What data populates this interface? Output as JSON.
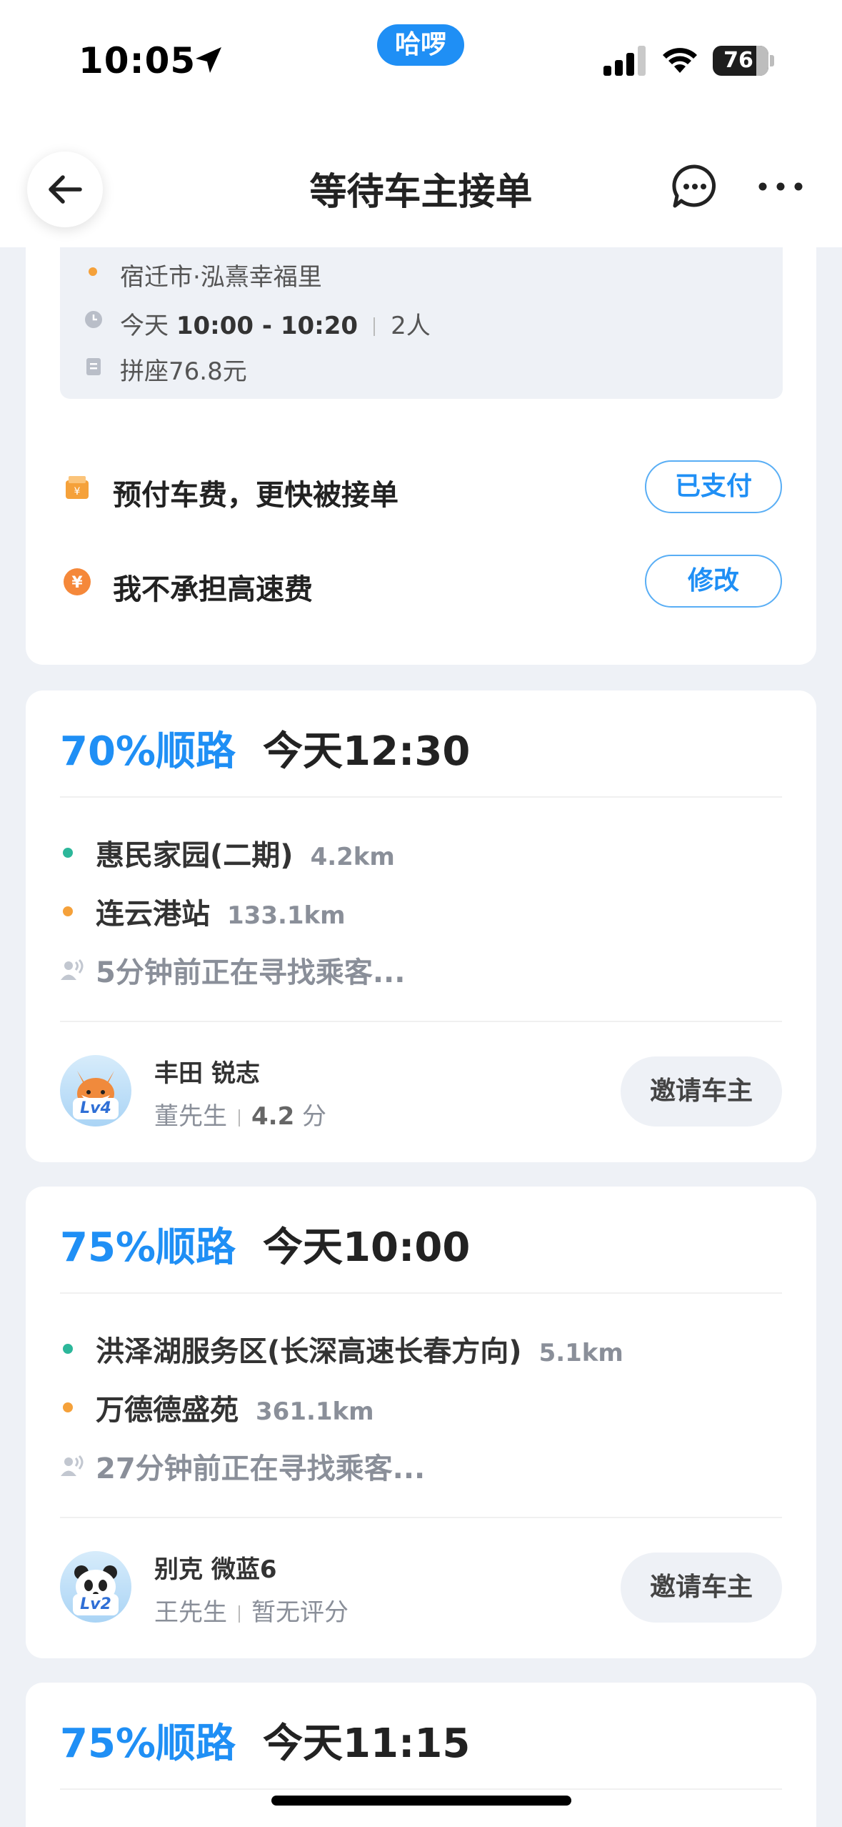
{
  "status_bar": {
    "time": "10:05",
    "pill": "哈啰",
    "battery": "76"
  },
  "nav": {
    "title": "等待车主接单",
    "icons": [
      "back-arrow-icon",
      "chat-bubble-icon",
      "more-dots-icon"
    ]
  },
  "summary": {
    "destination": "宿迁市·泓熹幸福里",
    "time_prefix": "今天",
    "time_range": "10:00 - 10:20",
    "passengers": "2人",
    "price": "拼座76.8元"
  },
  "options": [
    {
      "label": "预付车费，更快被接单",
      "button": "已支付",
      "icon": "wallet-icon"
    },
    {
      "label": "我不承担高速费",
      "button": "修改",
      "icon": "yen-coin-icon"
    }
  ],
  "rides": [
    {
      "match": "70%顺路",
      "time_prefix": "今天",
      "time": "12:30",
      "start": "惠民家园(二期)",
      "start_km": "4.2km",
      "end": "连云港站",
      "end_km": "133.1km",
      "status": "5分钟前正在寻找乘客...",
      "car": "丰田 锐志",
      "driver": "董先生",
      "score_value": "4.2",
      "score_unit": "分",
      "level": "Lv4",
      "avatar": "fox-avatar",
      "invite": "邀请车主"
    },
    {
      "match": "75%顺路",
      "time_prefix": "今天",
      "time": "10:00",
      "start": "洪泽湖服务区(长深高速长春方向)",
      "start_km": "5.1km",
      "end": "万德德盛苑",
      "end_km": "361.1km",
      "status": "27分钟前正在寻找乘客...",
      "car": "别克 微蓝6",
      "driver": "王先生",
      "score_text": "暂无评分",
      "level": "Lv2",
      "avatar": "panda-avatar",
      "invite": "邀请车主"
    },
    {
      "match": "75%顺路",
      "time_prefix": "今天",
      "time": "11:15"
    }
  ],
  "colors": {
    "accent": "#1f8ff5",
    "start_dot": "#2cb79a",
    "end_dot": "#f5a13a",
    "background": "#eef1f6"
  }
}
